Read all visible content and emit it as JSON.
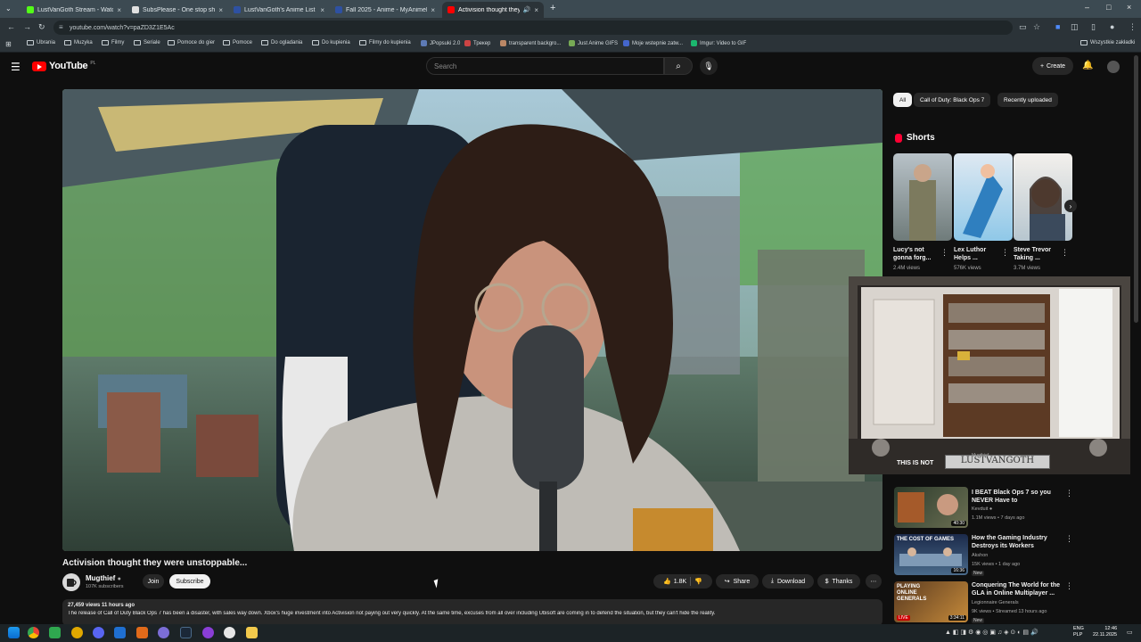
{
  "browser": {
    "tabs": [
      {
        "title": "LustVanGoth Stream - Watch L",
        "color": "#53fc18"
      },
      {
        "title": "SubsPlease - One stop shop fo",
        "color": "#e0e0e0"
      },
      {
        "title": "LustVanGoth's Anime List - My",
        "color": "#2e51a2"
      },
      {
        "title": "Fall 2025 - Anime - MyAnimeLi",
        "color": "#2e51a2"
      },
      {
        "title": "Activision thought they we",
        "color": "#ff0000"
      }
    ],
    "new_tab": "+",
    "url": "youtube.com/watch?v=paZD3Z1E5Ac",
    "bookmarks": [
      "Ubrania",
      "Muzyka",
      "Filmy",
      "Seriale",
      "Pomoce do gier",
      "Pomoce",
      "Do ogladania",
      "Do kupienia",
      "Filmy do kupienia",
      "JPopsuki 2.0",
      "Трекер",
      "transparent backgro...",
      "Just Anime GIFS",
      "Moje wstepnie zatw...",
      "Imgur: Video to GIF"
    ],
    "bookmarks_all": "Wszystkie zakładki"
  },
  "youtube": {
    "logo": "YouTube",
    "country": "PL",
    "search_placeholder": "Search",
    "create_label": "Create"
  },
  "video": {
    "title": "Activision thought they were unstoppable...",
    "channel": "Mugthief",
    "subscribers": "107K subscribers",
    "join_label": "Join",
    "subscribe_label": "Subscribe",
    "likes": "1.8K",
    "share_label": "Share",
    "download_label": "Download",
    "thanks_label": "Thanks",
    "views_line": "27,459 views  11 hours ago",
    "description": "The release of Call of Duty Black Ops 7 has been a disaster, with sales way down. Xbox's huge investment into Activision not paying out very quickly. At the same time, excuses from all over including Ubisoft are coming in to defend the situation, but they can't hide the reality."
  },
  "sidebar": {
    "chips": [
      "All",
      "Call of Duty: Black Ops 7",
      "Recently uploaded"
    ],
    "shorts_heading": "Shorts",
    "shorts": [
      {
        "title": "Lucy's not gonna forg...",
        "views": "2.4M views"
      },
      {
        "title": "Lex Luthor Helps ...",
        "views": "576K views"
      },
      {
        "title": "Steve Trevor Taking ...",
        "views": "3.7M views"
      }
    ],
    "webcam_caption": "THIS IS NOT",
    "webcam_name": "LUSTVANGOTH",
    "webcam_channel": "Mugthief",
    "recommended": [
      {
        "title": "I BEAT Black Ops 7 so you NEVER Have to",
        "channel": "Kevduit",
        "meta": "1.1M views • 7 days ago",
        "duration": "40:30",
        "badge": ""
      },
      {
        "title": "How the Gaming Industry Destroys its Workers",
        "channel": "Akshon",
        "meta": "15K views • 1 day ago",
        "duration": "16:36",
        "badge": "New",
        "thumb_text": "THE COST OF GAMES"
      },
      {
        "title": "Conquering The World for the GLA in Online Multiplayer ...",
        "channel": "Legionnaire Generals",
        "meta": "9K views • Streamed 13 hours ago",
        "duration": "3:34:11",
        "badge": "New",
        "live": "LIVE",
        "thumb_text": "PLAYING ONLINE GENERALS"
      }
    ]
  },
  "taskbar": {
    "lang": "ENG",
    "locale": "PLP",
    "time": "12:46",
    "date": "22.11.2025"
  },
  "colors": {
    "background": "#0f0f0f",
    "youtube_red": "#ff0000",
    "pill": "#272727"
  }
}
